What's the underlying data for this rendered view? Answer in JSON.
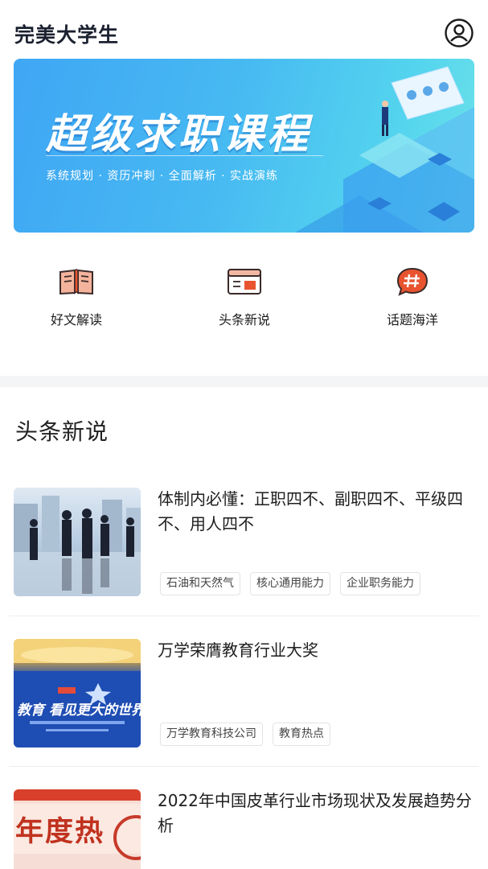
{
  "header": {
    "app_title": "完美大学生",
    "profile_icon": "user-circle-icon"
  },
  "banner": {
    "title": "超级求职课程",
    "subtitle": "系统规划 · 资历冲刺 · 全面解析 · 实战演练",
    "colors": {
      "start": "#3fa6f4",
      "end": "#6ee3e8"
    }
  },
  "quick_links": [
    {
      "label": "好文解读",
      "icon": "open-book-icon"
    },
    {
      "label": "头条新说",
      "icon": "browser-window-icon"
    },
    {
      "label": "话题海洋",
      "icon": "hashtag-bubble-icon"
    }
  ],
  "section": {
    "title": "头条新说"
  },
  "articles": [
    {
      "title": "体制内必懂：正职四不、副职四不、平级四不、用人四不",
      "tags": [
        "石油和天然气",
        "核心通用能力",
        "企业职务能力"
      ],
      "thumb": "business-meeting-photo"
    },
    {
      "title": "万学荣膺教育行业大奖",
      "tags": [
        "万学教育科技公司",
        "教育热点"
      ],
      "thumb": "award-stage-photo",
      "thumb_text": "教育 看见更大的世界"
    },
    {
      "title": "2022年中国皮革行业市场现状及发展趋势分析",
      "tags": [],
      "thumb": "annual-hot-banner",
      "thumb_text": "年度热"
    }
  ],
  "accent": "#e8542f"
}
